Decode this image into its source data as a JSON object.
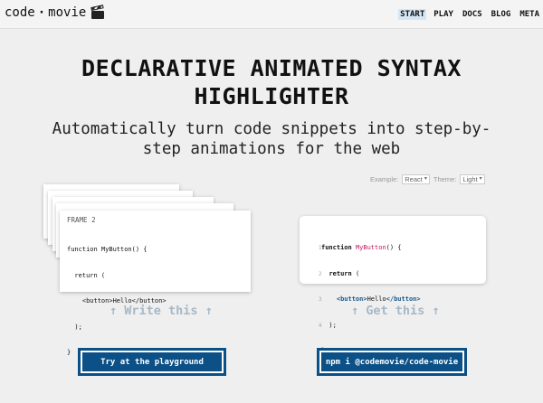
{
  "nav": {
    "logo_left": "code",
    "logo_right": "movie",
    "logo_icon": "clapperboard-icon",
    "items": [
      "START",
      "PLAY",
      "DOCS",
      "BLOG",
      "META"
    ],
    "active_item": "START",
    "active_color": "#d3e6f5"
  },
  "hero": {
    "title_line1": "DECLARATIVE ANIMATED SYNTAX",
    "title_line2": "HIGHLIGHTER",
    "subtitle_line1": "Automatically turn code snippets into step-by-",
    "subtitle_line2": "step animations for the web"
  },
  "controls": {
    "example_label": "Example:",
    "example_value": "React",
    "theme_label": "Theme:",
    "theme_value": "Light"
  },
  "input_stack": {
    "frame_label": "FRAME 2",
    "code_lines": [
      "function MyButton() {",
      "  return (",
      "    <button>Hello</button>",
      "  );",
      "}"
    ]
  },
  "output": {
    "line_numbers": [
      "1",
      "2",
      "3",
      "4",
      "5"
    ],
    "fn_keyword": "function",
    "fn_name": "MyButton",
    "fn_tail": "() {",
    "return_kw": "return",
    "return_tail": " (",
    "open_tag": "<button>",
    "inner_text": "Hello",
    "close_tag": "</button>",
    "line4": "  );",
    "line5": "}",
    "accent_fn": "#c0185c",
    "accent_tag": "#1a5a8a"
  },
  "captions": {
    "write": "↑ Write this ↑",
    "get": "↑ Get this ↑",
    "color": "#a6b8c7"
  },
  "buttons": {
    "playground": "Try at the playground",
    "npm": "npm i @codemovie/code-movie",
    "color": "#0b5086"
  }
}
